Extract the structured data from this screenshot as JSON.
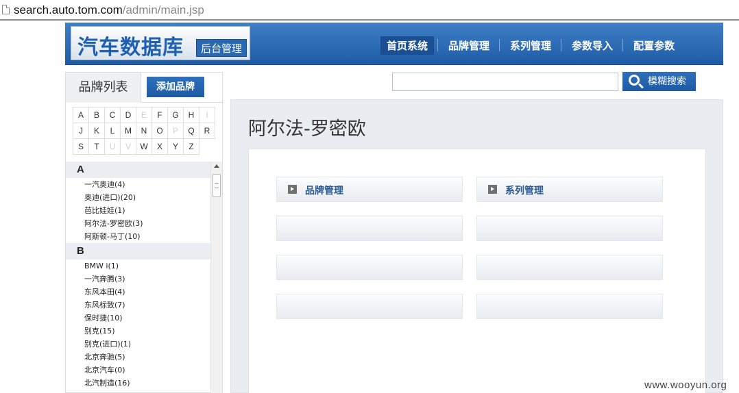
{
  "browser": {
    "url_host": "search.auto.tom.com",
    "url_path": "/admin/main.jsp",
    "page_icon": "page-icon"
  },
  "header": {
    "logo_main": "汽车数据库",
    "logo_sub": "后台管理",
    "nav": [
      "首页系统",
      "品牌管理",
      "系列管理",
      "参数导入",
      "配置参数"
    ],
    "active_nav": "首页系统",
    "bg_color": "#2a6bb6"
  },
  "sidebar": {
    "title": "品牌列表",
    "add_button": "添加品牌",
    "letters": [
      {
        "l": "A",
        "enabled": true
      },
      {
        "l": "B",
        "enabled": true
      },
      {
        "l": "C",
        "enabled": true
      },
      {
        "l": "D",
        "enabled": true
      },
      {
        "l": "E",
        "enabled": false
      },
      {
        "l": "F",
        "enabled": true
      },
      {
        "l": "G",
        "enabled": true
      },
      {
        "l": "H",
        "enabled": true
      },
      {
        "l": "I",
        "enabled": false
      },
      {
        "l": "J",
        "enabled": true
      },
      {
        "l": "K",
        "enabled": true
      },
      {
        "l": "L",
        "enabled": true
      },
      {
        "l": "M",
        "enabled": true
      },
      {
        "l": "N",
        "enabled": true
      },
      {
        "l": "O",
        "enabled": true
      },
      {
        "l": "P",
        "enabled": false
      },
      {
        "l": "Q",
        "enabled": true
      },
      {
        "l": "R",
        "enabled": true
      },
      {
        "l": "S",
        "enabled": true
      },
      {
        "l": "T",
        "enabled": true
      },
      {
        "l": "U",
        "enabled": false
      },
      {
        "l": "V",
        "enabled": false
      },
      {
        "l": "W",
        "enabled": true
      },
      {
        "l": "X",
        "enabled": true
      },
      {
        "l": "Y",
        "enabled": true
      },
      {
        "l": "Z",
        "enabled": true
      }
    ],
    "groups": [
      {
        "letter": "A",
        "items": [
          "一汽奥迪(4)",
          "奥迪(进口)(20)",
          "芭比娃娃(1)",
          "阿尔法-罗密欧(3)",
          "阿斯顿-马丁(10)"
        ]
      },
      {
        "letter": "B",
        "items": [
          "BMW i(1)",
          "一汽奔腾(3)",
          "东风本田(4)",
          "东风标致(7)",
          "保时捷(10)",
          "别克(15)",
          "别克(进口)(1)",
          "北京奔驰(5)",
          "北京汽车(0)",
          "北汽制造(16)"
        ]
      }
    ]
  },
  "search": {
    "placeholder": "",
    "button_label": "模糊搜索"
  },
  "main": {
    "title": "阿尔法-罗密欧",
    "tiles": [
      {
        "label": "品牌管理",
        "has_icon": true
      },
      {
        "label": "系列管理",
        "has_icon": true
      },
      {
        "label": "",
        "has_icon": false
      },
      {
        "label": "",
        "has_icon": false
      },
      {
        "label": "",
        "has_icon": false
      },
      {
        "label": "",
        "has_icon": false
      },
      {
        "label": "",
        "has_icon": false
      },
      {
        "label": "",
        "has_icon": false
      }
    ]
  },
  "watermark": "www.wooyun.org"
}
